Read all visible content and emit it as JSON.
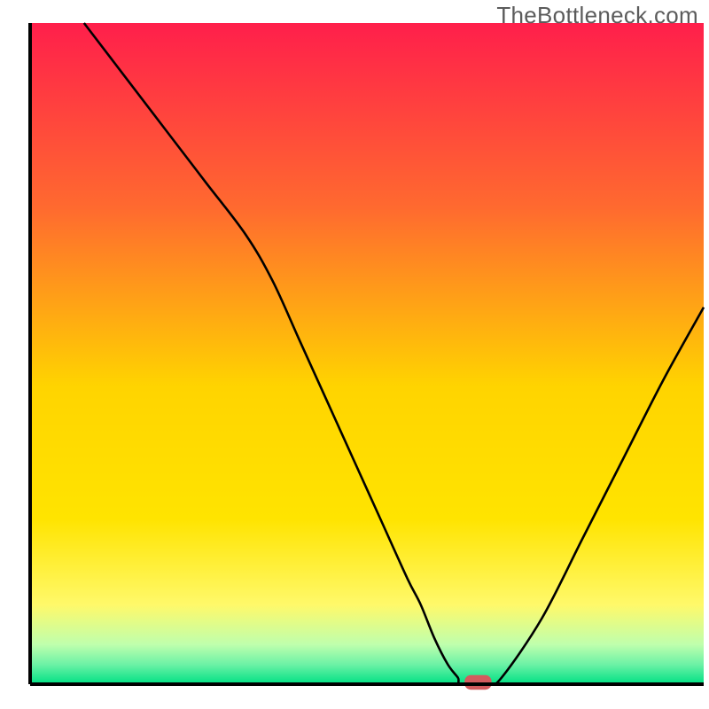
{
  "watermark": "TheBottleneck.com",
  "chart_data": {
    "type": "line",
    "title": "",
    "xlabel": "",
    "ylabel": "",
    "xlim": [
      0,
      100
    ],
    "ylim": [
      0,
      100
    ],
    "legend": false,
    "grid": false,
    "background_gradient": {
      "top": "#ff1f4b",
      "upper_mid": "#ff8a2b",
      "mid": "#ffd400",
      "lower_mid": "#fff96a",
      "near_bottom": "#bfffad",
      "bottom": "#00e084"
    },
    "series": [
      {
        "name": "bottleneck-curve",
        "stroke": "#000000",
        "stroke_width": 2,
        "x": [
          8,
          14,
          20,
          26,
          32,
          36,
          40,
          44,
          48,
          52,
          56,
          58,
          60,
          62,
          63.5,
          64,
          68,
          70,
          76,
          82,
          88,
          94,
          100
        ],
        "y": [
          100,
          92,
          84,
          76,
          68,
          61,
          52,
          43,
          34,
          25,
          16,
          12,
          7,
          3,
          1,
          0,
          0,
          1,
          10,
          22,
          34,
          46,
          57
        ]
      }
    ],
    "marker": {
      "name": "sweet-spot-marker",
      "shape": "rounded-rect",
      "fill": "#d35b5e",
      "x_center": 66.5,
      "y_center": 0,
      "width": 4,
      "height": 2.2
    },
    "frame": {
      "left": true,
      "bottom": true,
      "right": false,
      "top": false,
      "stroke": "#000000",
      "stroke_width": 4
    }
  }
}
